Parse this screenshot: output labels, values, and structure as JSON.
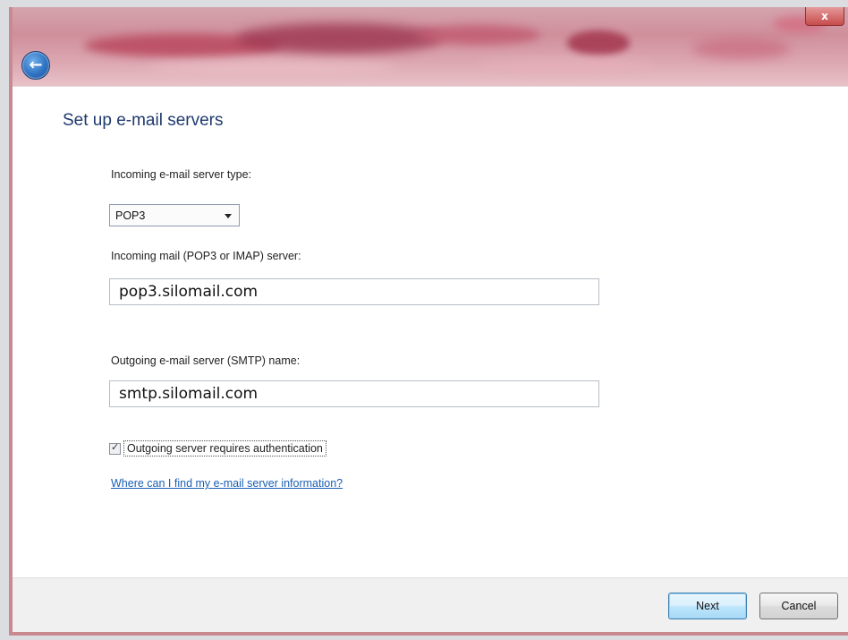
{
  "window": {
    "close_glyph": "x",
    "back_glyph": "←"
  },
  "page": {
    "title": "Set up e-mail servers"
  },
  "form": {
    "incoming_type_label": "Incoming e-mail server type:",
    "incoming_type_value": "POP3",
    "incoming_server_label": "Incoming mail (POP3 or IMAP) server:",
    "incoming_server_value": "pop3.silomail.com",
    "outgoing_server_label": "Outgoing e-mail server (SMTP) name:",
    "outgoing_server_value": "smtp.silomail.com",
    "auth_checkbox_label": "Outgoing server requires authentication",
    "auth_checked": true,
    "help_link": "Where can I find my e-mail server information?"
  },
  "footer": {
    "next_label": "Next",
    "cancel_label": "Cancel"
  },
  "colors": {
    "title_text": "#1f3a6e",
    "link": "#1a5fb4",
    "frame_accent": "#c88a90"
  }
}
